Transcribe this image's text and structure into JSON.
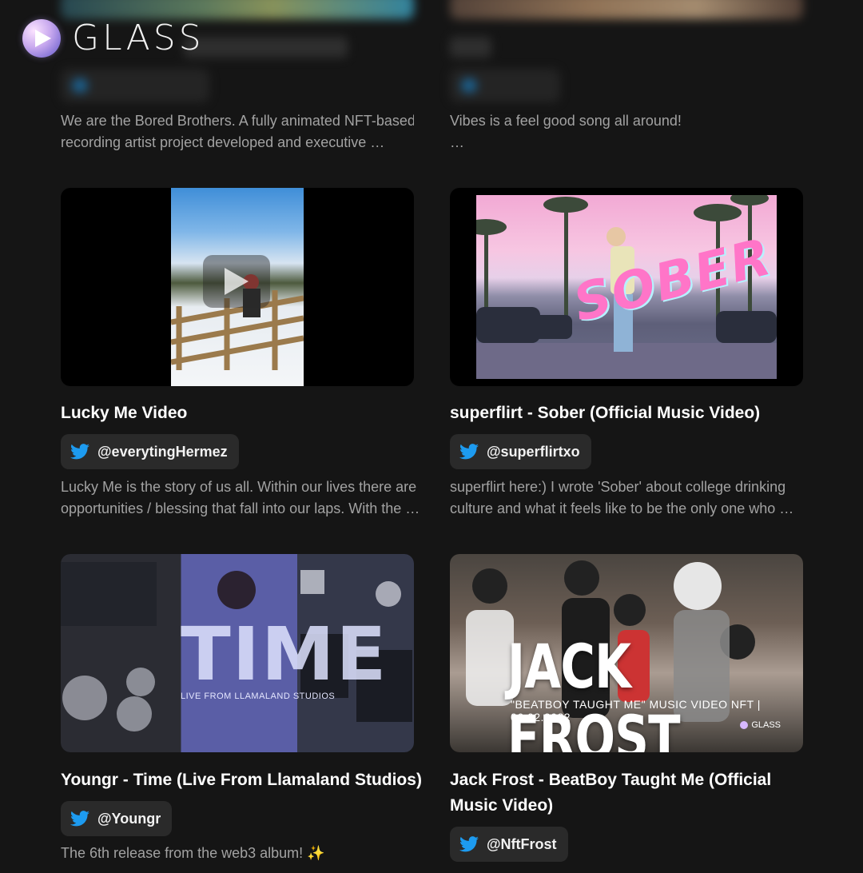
{
  "brand": {
    "name": "GLASS"
  },
  "top_cards": [
    {
      "description_lines": [
        "We are the Bored Brothers. A fully animated NFT-based",
        "recording artist project developed and executive …"
      ]
    },
    {
      "description_lines": [
        "Vibes is a feel good song all around!",
        "…"
      ]
    }
  ],
  "cards": [
    {
      "title": "Lucky Me Video",
      "handle": "@everytingHermez",
      "description_lines": [
        "Lucky Me is the story of us all. Within our lives there are",
        "opportunities / blessing that fall into our laps. With the …"
      ]
    },
    {
      "title": "superflirt - Sober (Official Music Video)",
      "handle": "@superflirtxo",
      "thumb_text": "SOBER",
      "description_lines": [
        "superflirt here:) I wrote 'Sober' about college drinking",
        "culture and what it feels like to be the only one who …"
      ]
    },
    {
      "title": "Youngr - Time (Live From Llamaland Studios)",
      "handle": "@Youngr",
      "thumb_text": "TIME",
      "thumb_subtext": "LIVE FROM LLAMALAND STUDIOS",
      "description_lines": [
        "The 6th release from the web3 album! ✨"
      ]
    },
    {
      "title_lines": [
        "Jack Frost - BeatBoy Taught Me (Official",
        "Music Video)"
      ],
      "handle": "@NftFrost",
      "thumb_text": "JACK FROST",
      "thumb_subtext": "\"BEATBOY TAUGHT ME\"  MUSIC VIDEO NFT | 06.02.2022",
      "thumb_logo": "GLASS"
    }
  ],
  "colors": {
    "background": "#151515",
    "chip": "#2a2a2a",
    "twitter": "#1d9bf0",
    "desc": "#a2a2a2"
  }
}
